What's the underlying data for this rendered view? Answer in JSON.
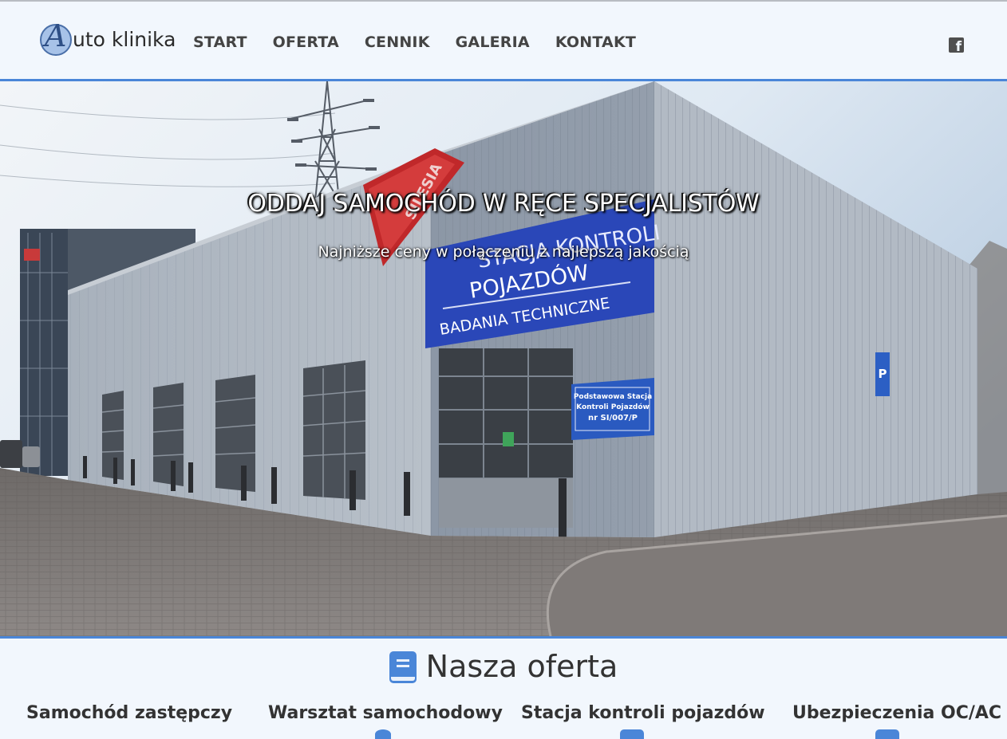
{
  "brand": {
    "logo_letter": "A",
    "logo_text": "uto klinika"
  },
  "nav": {
    "items": [
      "START",
      "OFERTA",
      "CENNIK",
      "GALERIA",
      "KONTAKT"
    ],
    "social_icon": "facebook-icon",
    "social_glyph": "f"
  },
  "hero": {
    "title": "ODDAJ SAMOCHÓD W RĘCE SPECJALISTÓW",
    "subtitle": "Najniższe ceny w połączeniu z najlepszą jakością",
    "photo_banner": {
      "line1": "STACJA KONTROLI",
      "line2": "POJAZDÓW",
      "line3": "BADANIA TECHNICZNE"
    },
    "photo_sign": {
      "line1": "Podstawowa Stacja",
      "line2": "Kontroli Pojazdów",
      "line3": "nr SI/007/P"
    },
    "photo_red_sign": "SILESIA",
    "photo_parking": "P"
  },
  "offer": {
    "icon": "book-icon",
    "title": "Nasza oferta",
    "cards": [
      "Samochód zastępczy",
      "Warsztat samochodowy",
      "Stacja kontroli pojazdów",
      "Ubezpieczenia OC/AC"
    ]
  },
  "colors": {
    "accent": "#4a86d8",
    "background": "#f2f7fd",
    "text": "#333333"
  }
}
